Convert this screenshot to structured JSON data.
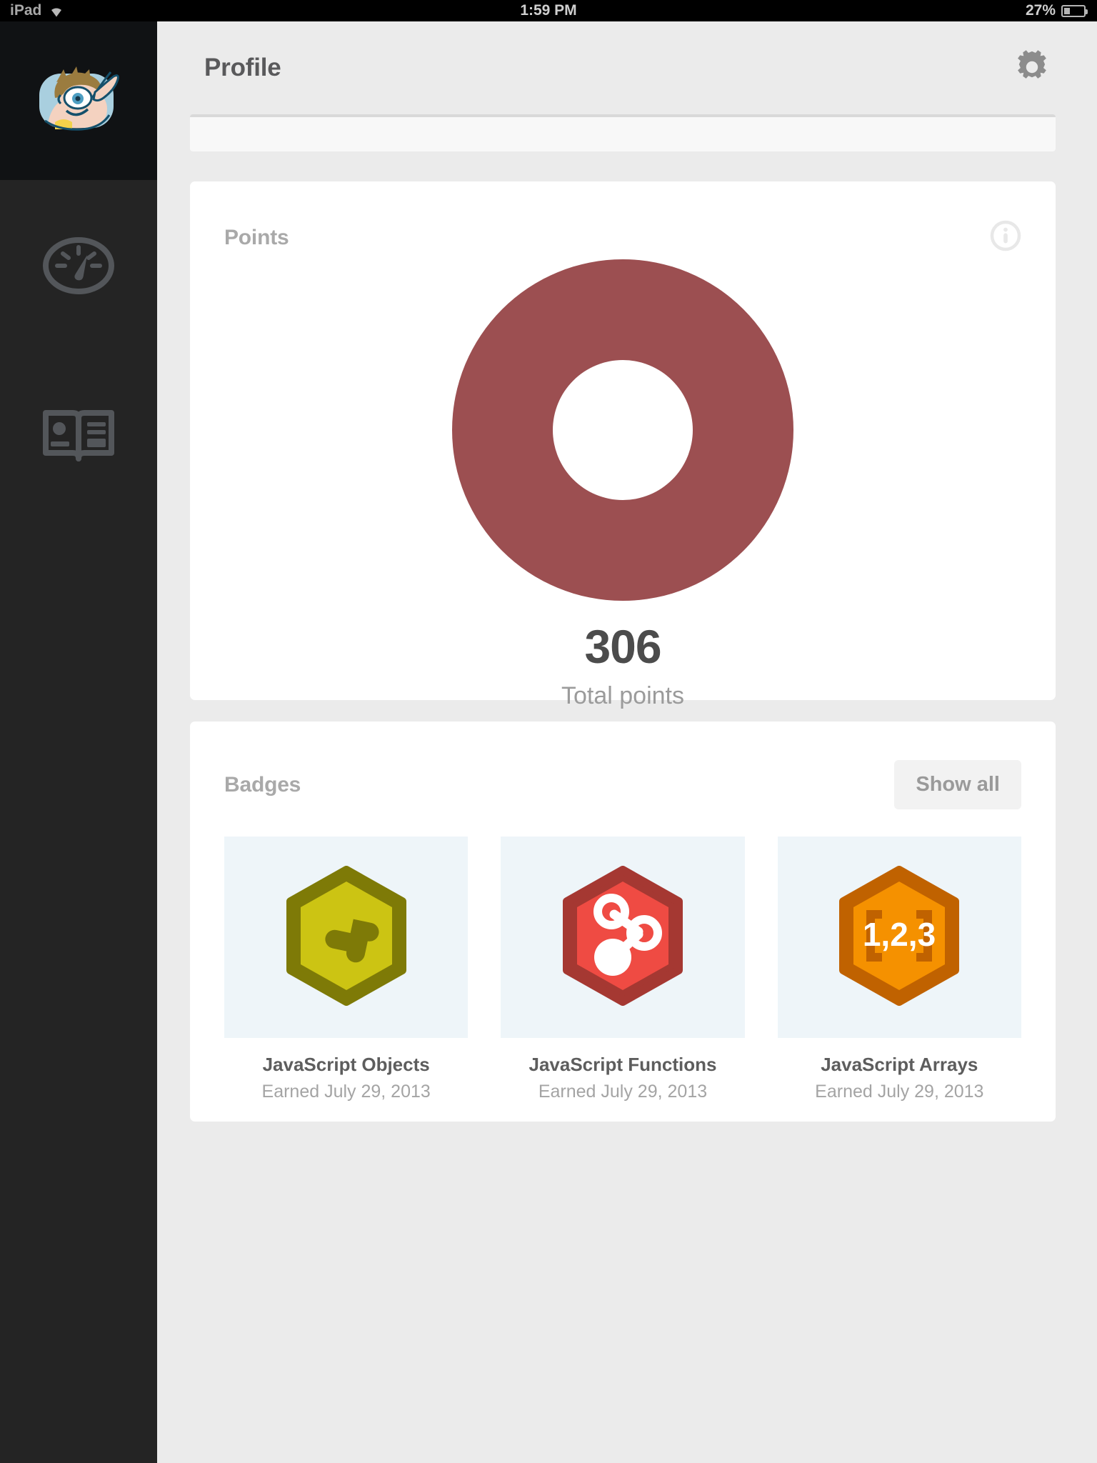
{
  "statusbar": {
    "device_label": "iPad",
    "wifi_icon": "wifi-icon",
    "time": "1:59 PM",
    "battery_percent": "27%",
    "battery_icon": "battery-icon",
    "battery_level": 27
  },
  "sidebar": {
    "logo_icon": "treehouse-mascot-logo",
    "items": [
      {
        "icon": "dashboard-speedometer-icon",
        "name": "dashboard"
      },
      {
        "icon": "library-book-icon",
        "name": "library"
      }
    ]
  },
  "header": {
    "title": "Profile",
    "settings_icon": "gear-icon"
  },
  "points_card": {
    "title": "Points",
    "info_icon": "info-icon",
    "total": "306",
    "total_label": "Total points",
    "donut_color": "#9c4f51",
    "donut_hole_color": "#ffffff"
  },
  "badges_card": {
    "title": "Badges",
    "show_all_label": "Show all",
    "tile_background": "#eef5f9",
    "items": [
      {
        "name": "JavaScript Objects",
        "date": "Earned July 29, 2013",
        "icon": "puzzle-piece-hexagon-badge",
        "fill": "#ccc413",
        "border": "#7e7a07",
        "glyph_color": "#7e7a07"
      },
      {
        "name": "JavaScript Functions",
        "date": "Earned July 29, 2013",
        "icon": "molecule-hexagon-badge",
        "fill": "#ef4b43",
        "border": "#a53832",
        "glyph_color": "#ffffff"
      },
      {
        "name": "JavaScript Arrays",
        "date": "Earned July 29, 2013",
        "icon": "array-brackets-hexagon-badge",
        "label": "1,2,3",
        "fill": "#f59100",
        "border": "#c06200",
        "glyph_color": "#ffffff"
      }
    ]
  },
  "colors": {
    "page_background": "#ebebeb",
    "sidebar_background": "#242424",
    "card_background": "#ffffff",
    "accent": "#9c4f51"
  }
}
